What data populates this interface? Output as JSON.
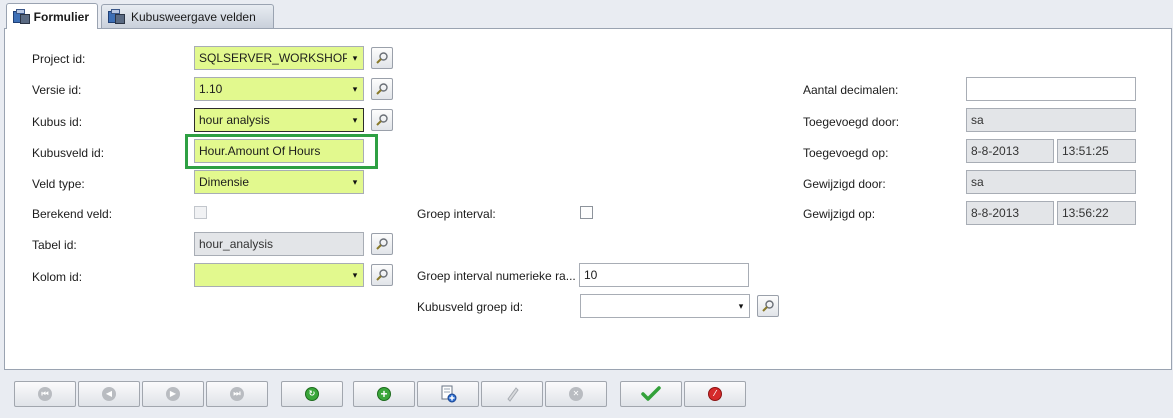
{
  "tabs": [
    {
      "label": "Formulier",
      "active": true
    },
    {
      "label": "Kubusweergave velden",
      "active": false
    }
  ],
  "form": {
    "project_id": {
      "label": "Project id:",
      "value": "SQLSERVER_WORKSHOP"
    },
    "versie_id": {
      "label": "Versie id:",
      "value": "1.10"
    },
    "kubus_id": {
      "label": "Kubus id:",
      "value": "hour analysis"
    },
    "kubusveld_id": {
      "label": "Kubusveld id:",
      "value": "Hour.Amount Of Hours"
    },
    "veld_type": {
      "label": "Veld type:",
      "value": "Dimensie"
    },
    "berekend_veld": {
      "label": "Berekend veld:",
      "checked": false
    },
    "tabel_id": {
      "label": "Tabel id:",
      "value": "hour_analysis"
    },
    "kolom_id": {
      "label": "Kolom id:",
      "value": ""
    },
    "groep_interval": {
      "label": "Groep interval:",
      "checked": false
    },
    "groep_interval_numeriek": {
      "label": "Groep  interval  numerieke  ra...",
      "value": "10"
    },
    "kubusveld_groep_id": {
      "label": "Kubusveld groep id:",
      "value": ""
    },
    "aantal_decimalen": {
      "label": "Aantal decimalen:",
      "value": ""
    },
    "toegevoegd_door": {
      "label": "Toegevoegd door:",
      "value": "sa"
    },
    "toegevoegd_op": {
      "label": "Toegevoegd op:",
      "date": "8-8-2013",
      "time": "13:51:25"
    },
    "gewijzigd_door": {
      "label": "Gewijzigd door:",
      "value": "sa"
    },
    "gewijzigd_op": {
      "label": "Gewijzigd op:",
      "date": "8-8-2013",
      "time": "13:56:22"
    }
  },
  "colors": {
    "required_field": "#e2f98e",
    "readonly_field": "#e3e5e8",
    "highlight_box": "#2ea043"
  },
  "icons": {
    "dropdown": "▾",
    "lookup": "magnifier-icon",
    "first": "first-record-icon",
    "previous": "previous-record-icon",
    "next": "next-record-icon",
    "last": "last-record-icon",
    "refresh": "refresh-icon",
    "add": "add-icon",
    "copy": "copy-record-icon",
    "edit": "edit-icon",
    "delete": "delete-icon",
    "save": "checkmark-icon",
    "cancel": "cancel-icon"
  }
}
